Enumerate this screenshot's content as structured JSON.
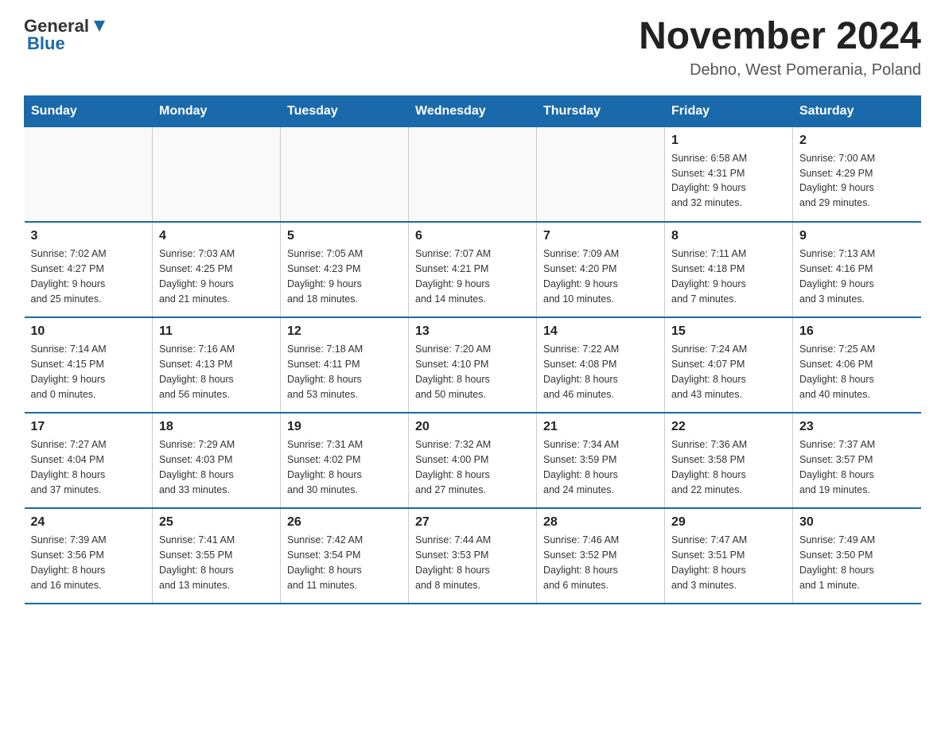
{
  "logo": {
    "general": "General",
    "blue": "Blue"
  },
  "header": {
    "title": "November 2024",
    "subtitle": "Debno, West Pomerania, Poland"
  },
  "weekdays": [
    "Sunday",
    "Monday",
    "Tuesday",
    "Wednesday",
    "Thursday",
    "Friday",
    "Saturday"
  ],
  "weeks": [
    [
      {
        "day": "",
        "info": ""
      },
      {
        "day": "",
        "info": ""
      },
      {
        "day": "",
        "info": ""
      },
      {
        "day": "",
        "info": ""
      },
      {
        "day": "",
        "info": ""
      },
      {
        "day": "1",
        "info": "Sunrise: 6:58 AM\nSunset: 4:31 PM\nDaylight: 9 hours\nand 32 minutes."
      },
      {
        "day": "2",
        "info": "Sunrise: 7:00 AM\nSunset: 4:29 PM\nDaylight: 9 hours\nand 29 minutes."
      }
    ],
    [
      {
        "day": "3",
        "info": "Sunrise: 7:02 AM\nSunset: 4:27 PM\nDaylight: 9 hours\nand 25 minutes."
      },
      {
        "day": "4",
        "info": "Sunrise: 7:03 AM\nSunset: 4:25 PM\nDaylight: 9 hours\nand 21 minutes."
      },
      {
        "day": "5",
        "info": "Sunrise: 7:05 AM\nSunset: 4:23 PM\nDaylight: 9 hours\nand 18 minutes."
      },
      {
        "day": "6",
        "info": "Sunrise: 7:07 AM\nSunset: 4:21 PM\nDaylight: 9 hours\nand 14 minutes."
      },
      {
        "day": "7",
        "info": "Sunrise: 7:09 AM\nSunset: 4:20 PM\nDaylight: 9 hours\nand 10 minutes."
      },
      {
        "day": "8",
        "info": "Sunrise: 7:11 AM\nSunset: 4:18 PM\nDaylight: 9 hours\nand 7 minutes."
      },
      {
        "day": "9",
        "info": "Sunrise: 7:13 AM\nSunset: 4:16 PM\nDaylight: 9 hours\nand 3 minutes."
      }
    ],
    [
      {
        "day": "10",
        "info": "Sunrise: 7:14 AM\nSunset: 4:15 PM\nDaylight: 9 hours\nand 0 minutes."
      },
      {
        "day": "11",
        "info": "Sunrise: 7:16 AM\nSunset: 4:13 PM\nDaylight: 8 hours\nand 56 minutes."
      },
      {
        "day": "12",
        "info": "Sunrise: 7:18 AM\nSunset: 4:11 PM\nDaylight: 8 hours\nand 53 minutes."
      },
      {
        "day": "13",
        "info": "Sunrise: 7:20 AM\nSunset: 4:10 PM\nDaylight: 8 hours\nand 50 minutes."
      },
      {
        "day": "14",
        "info": "Sunrise: 7:22 AM\nSunset: 4:08 PM\nDaylight: 8 hours\nand 46 minutes."
      },
      {
        "day": "15",
        "info": "Sunrise: 7:24 AM\nSunset: 4:07 PM\nDaylight: 8 hours\nand 43 minutes."
      },
      {
        "day": "16",
        "info": "Sunrise: 7:25 AM\nSunset: 4:06 PM\nDaylight: 8 hours\nand 40 minutes."
      }
    ],
    [
      {
        "day": "17",
        "info": "Sunrise: 7:27 AM\nSunset: 4:04 PM\nDaylight: 8 hours\nand 37 minutes."
      },
      {
        "day": "18",
        "info": "Sunrise: 7:29 AM\nSunset: 4:03 PM\nDaylight: 8 hours\nand 33 minutes."
      },
      {
        "day": "19",
        "info": "Sunrise: 7:31 AM\nSunset: 4:02 PM\nDaylight: 8 hours\nand 30 minutes."
      },
      {
        "day": "20",
        "info": "Sunrise: 7:32 AM\nSunset: 4:00 PM\nDaylight: 8 hours\nand 27 minutes."
      },
      {
        "day": "21",
        "info": "Sunrise: 7:34 AM\nSunset: 3:59 PM\nDaylight: 8 hours\nand 24 minutes."
      },
      {
        "day": "22",
        "info": "Sunrise: 7:36 AM\nSunset: 3:58 PM\nDaylight: 8 hours\nand 22 minutes."
      },
      {
        "day": "23",
        "info": "Sunrise: 7:37 AM\nSunset: 3:57 PM\nDaylight: 8 hours\nand 19 minutes."
      }
    ],
    [
      {
        "day": "24",
        "info": "Sunrise: 7:39 AM\nSunset: 3:56 PM\nDaylight: 8 hours\nand 16 minutes."
      },
      {
        "day": "25",
        "info": "Sunrise: 7:41 AM\nSunset: 3:55 PM\nDaylight: 8 hours\nand 13 minutes."
      },
      {
        "day": "26",
        "info": "Sunrise: 7:42 AM\nSunset: 3:54 PM\nDaylight: 8 hours\nand 11 minutes."
      },
      {
        "day": "27",
        "info": "Sunrise: 7:44 AM\nSunset: 3:53 PM\nDaylight: 8 hours\nand 8 minutes."
      },
      {
        "day": "28",
        "info": "Sunrise: 7:46 AM\nSunset: 3:52 PM\nDaylight: 8 hours\nand 6 minutes."
      },
      {
        "day": "29",
        "info": "Sunrise: 7:47 AM\nSunset: 3:51 PM\nDaylight: 8 hours\nand 3 minutes."
      },
      {
        "day": "30",
        "info": "Sunrise: 7:49 AM\nSunset: 3:50 PM\nDaylight: 8 hours\nand 1 minute."
      }
    ]
  ]
}
